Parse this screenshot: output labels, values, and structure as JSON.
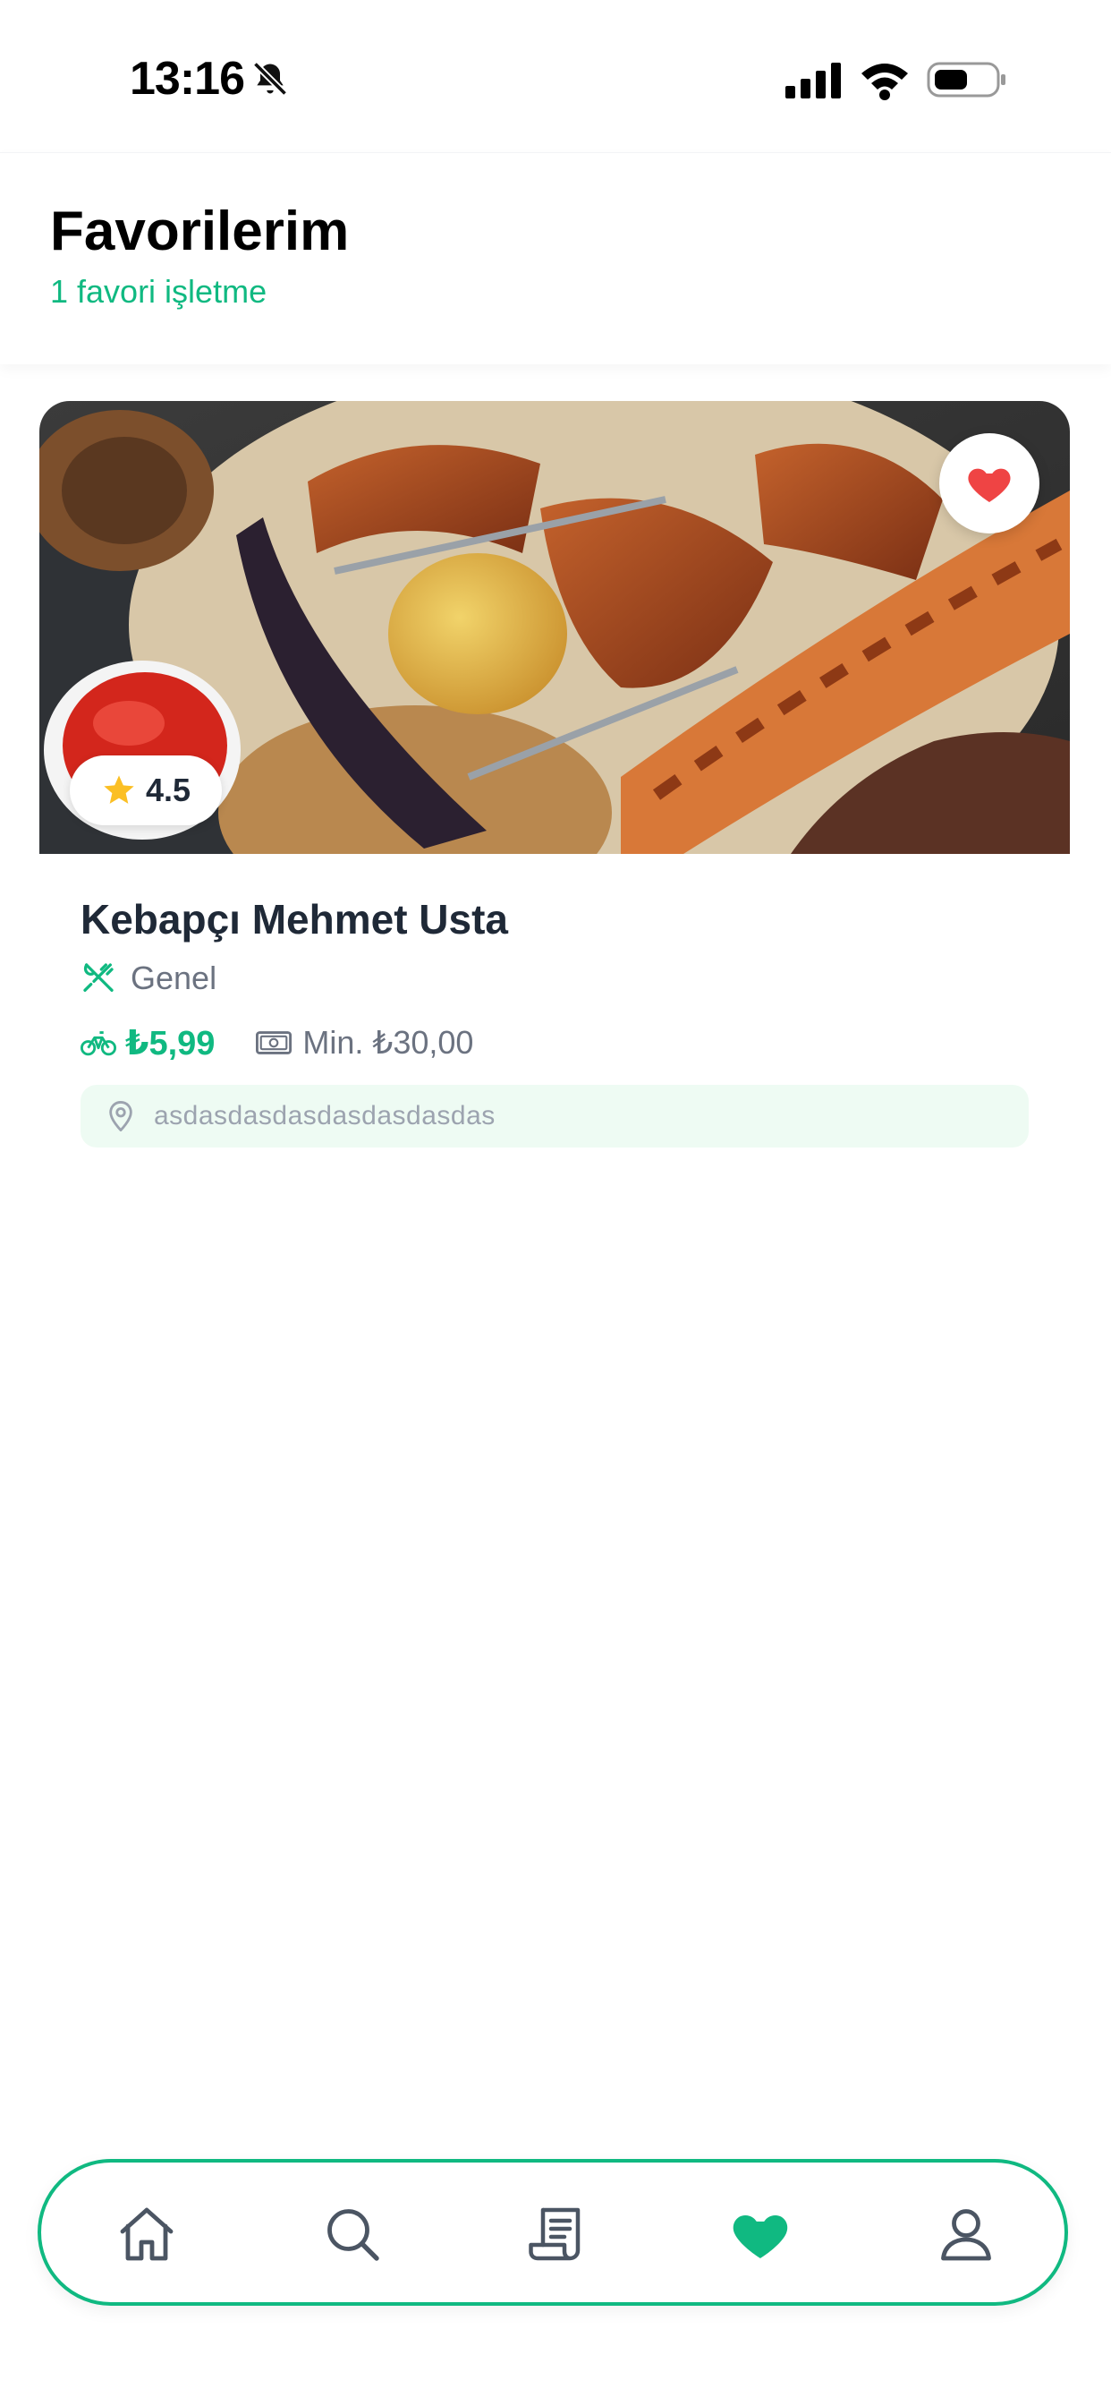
{
  "status_bar": {
    "time": "13:16",
    "icons": [
      "bell-slash-icon",
      "signal-icon",
      "wifi-icon",
      "battery-icon"
    ]
  },
  "header": {
    "title": "Favorilerim",
    "subtitle": "1 favori işletme"
  },
  "favorites": [
    {
      "name": "Kebapçı Mehmet Usta",
      "rating": "4.5",
      "category": "Genel",
      "delivery_fee": "₺5,99",
      "min_order": "Min. ₺30,00",
      "address": "asdasdasdasdasdasdasdas",
      "is_favorite": true,
      "image": "grilled kebab platter photo"
    }
  ],
  "bottom_nav": {
    "items": [
      {
        "id": "home",
        "icon": "home-icon",
        "active": false
      },
      {
        "id": "search",
        "icon": "search-icon",
        "active": false
      },
      {
        "id": "orders",
        "icon": "receipt-icon",
        "active": false
      },
      {
        "id": "favorites",
        "icon": "heart-icon",
        "active": true
      },
      {
        "id": "profile",
        "icon": "user-icon",
        "active": false
      }
    ]
  },
  "colors": {
    "accent": "#10b981",
    "heart": "#ef4444",
    "star": "#fbbf24",
    "address_bg": "#eefbf3"
  }
}
